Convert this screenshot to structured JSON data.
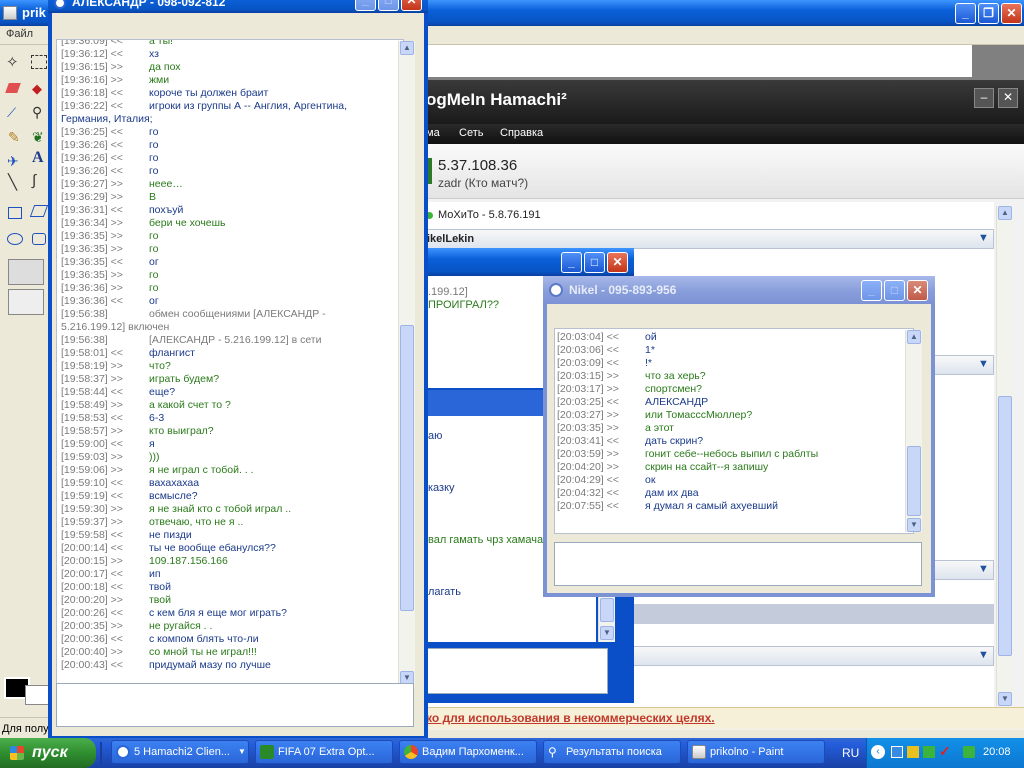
{
  "paint": {
    "title": "prikolno - Paint",
    "title_visible": "prik",
    "menu_file": "Файл",
    "status_text": "Для полу"
  },
  "hamachi": {
    "logo": "LogMeIn Hamachi²",
    "logo_visible": "ogMeIn Hamachi²",
    "menu": [
      "ма",
      "Сеть",
      "Справка"
    ],
    "ip": "5.37.108.36",
    "username": "zadr (Кто матч?)",
    "peer": "МоХиТо - 5.8.76.191",
    "network": "NikelLekin",
    "network_visible": "ikelLekin",
    "footer": "ко для использования в некоммерческих целях."
  },
  "middle_window": {
    "lines": [
      ".199.12]",
      "ПРОИГРАЛ??"
    ],
    "partials": [
      "аю",
      "казку",
      "вал гамать чрз хамача",
      "лагать"
    ]
  },
  "chat1": {
    "title": "АЛЕКСАНДР - 098-092-812",
    "first_partial": {
      "ts": "[19:36:09] <<",
      "text": "а ты!"
    },
    "lines": [
      {
        "ts": "[19:36:12] <<",
        "text": "хз",
        "dir": "in"
      },
      {
        "ts": "[19:36:15] >>",
        "text": "да пох",
        "dir": "out"
      },
      {
        "ts": "[19:36:16] >>",
        "text": "жми",
        "dir": "out"
      },
      {
        "ts": "[19:36:18] <<",
        "text": "короче ты должен браит",
        "dir": "in"
      },
      {
        "ts": "[19:36:22] <<",
        "text": "игроки из группы А -- Англия, Аргентина,",
        "dir": "in"
      },
      {
        "ts": "",
        "text": "Германия, Италия;",
        "dir": "in",
        "wrap": true
      },
      {
        "ts": "[19:36:25] <<",
        "text": "го",
        "dir": "in"
      },
      {
        "ts": "[19:36:26] <<",
        "text": "го",
        "dir": "in"
      },
      {
        "ts": "[19:36:26] <<",
        "text": "го",
        "dir": "in"
      },
      {
        "ts": "[19:36:26] <<",
        "text": "го",
        "dir": "in"
      },
      {
        "ts": "[19:36:27] >>",
        "text": "нeee…",
        "dir": "out"
      },
      {
        "ts": "[19:36:29] >>",
        "text": "В",
        "dir": "out"
      },
      {
        "ts": "[19:36:31] <<",
        "text": "похъуй",
        "dir": "in"
      },
      {
        "ts": "[19:36:34] >>",
        "text": "бери че хочешь",
        "dir": "out"
      },
      {
        "ts": "[19:36:35] >>",
        "text": "го",
        "dir": "out"
      },
      {
        "ts": "[19:36:35] >>",
        "text": "го",
        "dir": "out"
      },
      {
        "ts": "[19:36:35] <<",
        "text": "ог",
        "dir": "in"
      },
      {
        "ts": "[19:36:35] >>",
        "text": "го",
        "dir": "out"
      },
      {
        "ts": "[19:36:36] >>",
        "text": "го",
        "dir": "out"
      },
      {
        "ts": "[19:36:36] <<",
        "text": "ог",
        "dir": "in"
      },
      {
        "ts": "[19:56:38]",
        "text": "обмен сообщениями [АЛЕКСАНДР -",
        "dir": "sys"
      },
      {
        "ts": "",
        "text": "5.216.199.12] включен",
        "dir": "sys",
        "wrap": true
      },
      {
        "ts": "[19:56:38]",
        "text": "[АЛЕКСАНДР - 5.216.199.12] в сети",
        "dir": "sys"
      },
      {
        "ts": "[19:58:01] <<",
        "text": "флангист",
        "dir": "in"
      },
      {
        "ts": "[19:58:19] >>",
        "text": "что?",
        "dir": "out"
      },
      {
        "ts": "[19:58:37] >>",
        "text": "играть будем?",
        "dir": "out"
      },
      {
        "ts": "[19:58:44] <<",
        "text": "еще?",
        "dir": "in"
      },
      {
        "ts": "[19:58:49] >>",
        "text": "а какой счет то ?",
        "dir": "out"
      },
      {
        "ts": "[19:58:53] <<",
        "text": "6-3",
        "dir": "in"
      },
      {
        "ts": "[19:58:57] >>",
        "text": "кто выиграл?",
        "dir": "out"
      },
      {
        "ts": "[19:59:00] <<",
        "text": "я",
        "dir": "in"
      },
      {
        "ts": "[19:59:03] >>",
        "text": ")))",
        "dir": "out"
      },
      {
        "ts": "[19:59:06] >>",
        "text": "я не играл с тобой. . .",
        "dir": "out"
      },
      {
        "ts": "[19:59:10] <<",
        "text": "вахахахаа",
        "dir": "in"
      },
      {
        "ts": "[19:59:19] <<",
        "text": "всмысле?",
        "dir": "in"
      },
      {
        "ts": "[19:59:30] >>",
        "text": "я не знай кто с тобой играл ..",
        "dir": "out"
      },
      {
        "ts": "[19:59:37] >>",
        "text": "отвечаю, что не я ..",
        "dir": "out"
      },
      {
        "ts": "[19:59:58] <<",
        "text": "не пизди",
        "dir": "in"
      },
      {
        "ts": "[20:00:14] <<",
        "text": "ты че вообще ебанулся??",
        "dir": "in"
      },
      {
        "ts": "[20:00:15] >>",
        "text": "109.187.156.166",
        "dir": "out"
      },
      {
        "ts": "[20:00:17] <<",
        "text": "ип",
        "dir": "in"
      },
      {
        "ts": "[20:00:18] <<",
        "text": "твой",
        "dir": "in"
      },
      {
        "ts": "[20:00:20] >>",
        "text": "твой",
        "dir": "out"
      },
      {
        "ts": "[20:00:26] <<",
        "text": "с кем бля я еще мог играть?",
        "dir": "in"
      },
      {
        "ts": "[20:00:35] >>",
        "text": "не ругайся . .",
        "dir": "out"
      },
      {
        "ts": "[20:00:36] <<",
        "text": "с компом блять что-ли",
        "dir": "in"
      },
      {
        "ts": "[20:00:40] >>",
        "text": "со мной ты не играл!!!",
        "dir": "out"
      },
      {
        "ts": "[20:00:43] <<",
        "text": "придумай мазу по лучше",
        "dir": "in"
      }
    ]
  },
  "chat2": {
    "title": "Nikel - 095-893-956",
    "lines": [
      {
        "ts": "[20:03:04] <<",
        "text": "ой",
        "dir": "in"
      },
      {
        "ts": "[20:03:06] <<",
        "text": "1*",
        "dir": "in"
      },
      {
        "ts": "[20:03:09] <<",
        "text": "!*",
        "dir": "in"
      },
      {
        "ts": "[20:03:15] >>",
        "text": "что за херь?",
        "dir": "out"
      },
      {
        "ts": "[20:03:17] >>",
        "text": "спортсмен?",
        "dir": "out"
      },
      {
        "ts": "[20:03:25] <<",
        "text": "АЛЕКСАНДР",
        "dir": "in"
      },
      {
        "ts": "[20:03:27] >>",
        "text": "или ТомасссМюллер?",
        "dir": "out"
      },
      {
        "ts": "[20:03:35] >>",
        "text": "а этот",
        "dir": "out"
      },
      {
        "ts": "[20:03:41] <<",
        "text": "дать скрин?",
        "dir": "in"
      },
      {
        "ts": "[20:03:59] >>",
        "text": "гонит себе--небось выпил с раблты",
        "dir": "out"
      },
      {
        "ts": "[20:04:20] >>",
        "text": "скрин на ссайт--я запишу",
        "dir": "out"
      },
      {
        "ts": "[20:04:29] <<",
        "text": "ок",
        "dir": "in"
      },
      {
        "ts": "[20:04:32] <<",
        "text": "дам их два",
        "dir": "in"
      },
      {
        "ts": "[20:07:55] <<",
        "text": "я думал я самый ахуевший",
        "dir": "in"
      }
    ]
  },
  "taskbar": {
    "start": "пуск",
    "items": [
      "5 Hamachi2 Clien...",
      "FIFA 07 Extra Opt...",
      "Вадим Пархоменк...",
      "Результаты поиска",
      "prikolno - Paint"
    ],
    "lang": "RU",
    "clock": "20:08"
  },
  "colors": {
    "incoming": "#1a3a8a",
    "outgoing": "#2a7a1a",
    "timestamp": "#7a7a7a",
    "xp_blue": "#0a5fd8",
    "taskbar": "#245edb",
    "footer_text": "#c0392b"
  }
}
